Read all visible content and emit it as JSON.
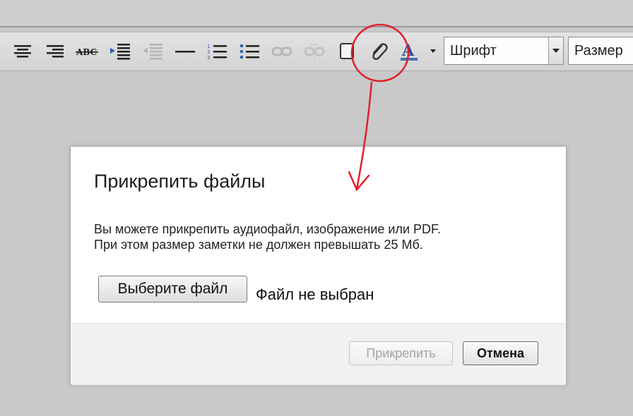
{
  "toolbar": {
    "icons": [
      "align-center-icon",
      "align-right-icon",
      "strikethrough-abc-icon",
      "indent-icon",
      "outdent-icon",
      "horizontal-rule-icon",
      "numbered-list-icon",
      "bulleted-list-icon",
      "link-icon",
      "unlink-icon",
      "checkbox-icon",
      "attachment-icon",
      "font-color-icon"
    ],
    "font_select": {
      "value": "Шрифт"
    },
    "size_select": {
      "value": "Размер"
    }
  },
  "dialog": {
    "title": "Прикрепить файлы",
    "description": [
      "Вы можете прикрепить аудиофайл, изображение или PDF.",
      "При этом размер заметки не должен превышать 25 Мб."
    ],
    "choose_file_label": "Выберите файл",
    "file_status": "Файл не выбран",
    "attach_label": "Прикрепить",
    "cancel_label": "Отмена"
  },
  "annotation": {
    "color": "#e0202a"
  },
  "colors": {
    "font_color_underline": "#4a6fb3",
    "list_blue": "#2d5fb0"
  }
}
